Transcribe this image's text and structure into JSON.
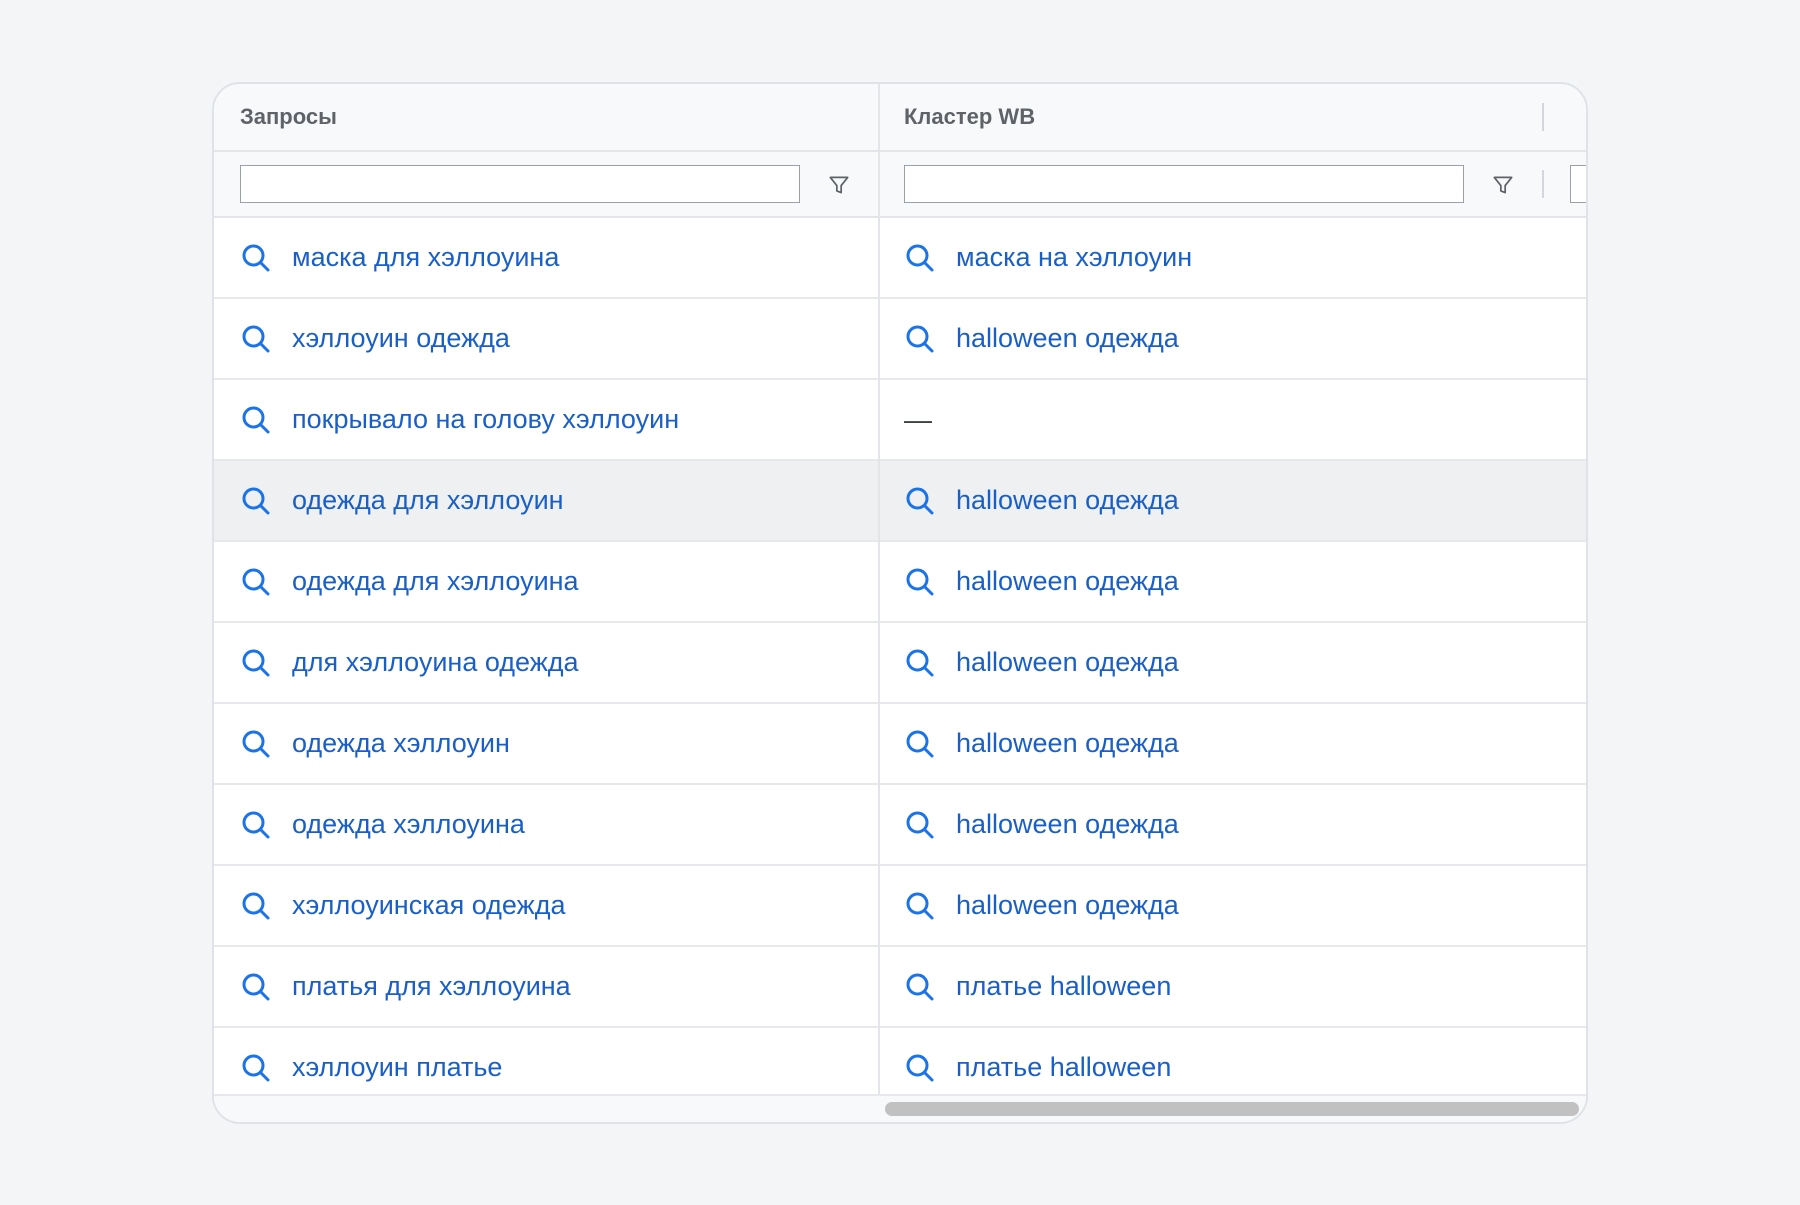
{
  "columns": {
    "queries": "Запросы",
    "cluster": "Кластер WB"
  },
  "filters": {
    "queries_value": "",
    "cluster_value": ""
  },
  "icons": {
    "row_icon": "search-icon",
    "filter_icon": "filter-icon"
  },
  "colors": {
    "link": "#1a5fc7",
    "icon": "#1a73e8"
  },
  "rows": [
    {
      "query": "маска для хэллоуина",
      "cluster": "маска на хэллоуин",
      "has_cluster": true
    },
    {
      "query": "хэллоуин одежда",
      "cluster": "halloween одежда",
      "has_cluster": true
    },
    {
      "query": "покрывало на голову хэллоуин",
      "cluster": "—",
      "has_cluster": false
    },
    {
      "query": "одежда для хэллоуин",
      "cluster": "halloween одежда",
      "has_cluster": true
    },
    {
      "query": "одежда для хэллоуина",
      "cluster": "halloween одежда",
      "has_cluster": true
    },
    {
      "query": "для хэллоуина одежда",
      "cluster": "halloween одежда",
      "has_cluster": true
    },
    {
      "query": "одежда хэллоуин",
      "cluster": "halloween одежда",
      "has_cluster": true
    },
    {
      "query": "одежда хэллоуина",
      "cluster": "halloween одежда",
      "has_cluster": true
    },
    {
      "query": "хэллоуинская одежда",
      "cluster": "halloween одежда",
      "has_cluster": true
    },
    {
      "query": "платья для хэллоуина",
      "cluster": "платье halloween",
      "has_cluster": true
    },
    {
      "query": "хэллоуин платье",
      "cluster": "платье halloween",
      "has_cluster": true
    }
  ]
}
